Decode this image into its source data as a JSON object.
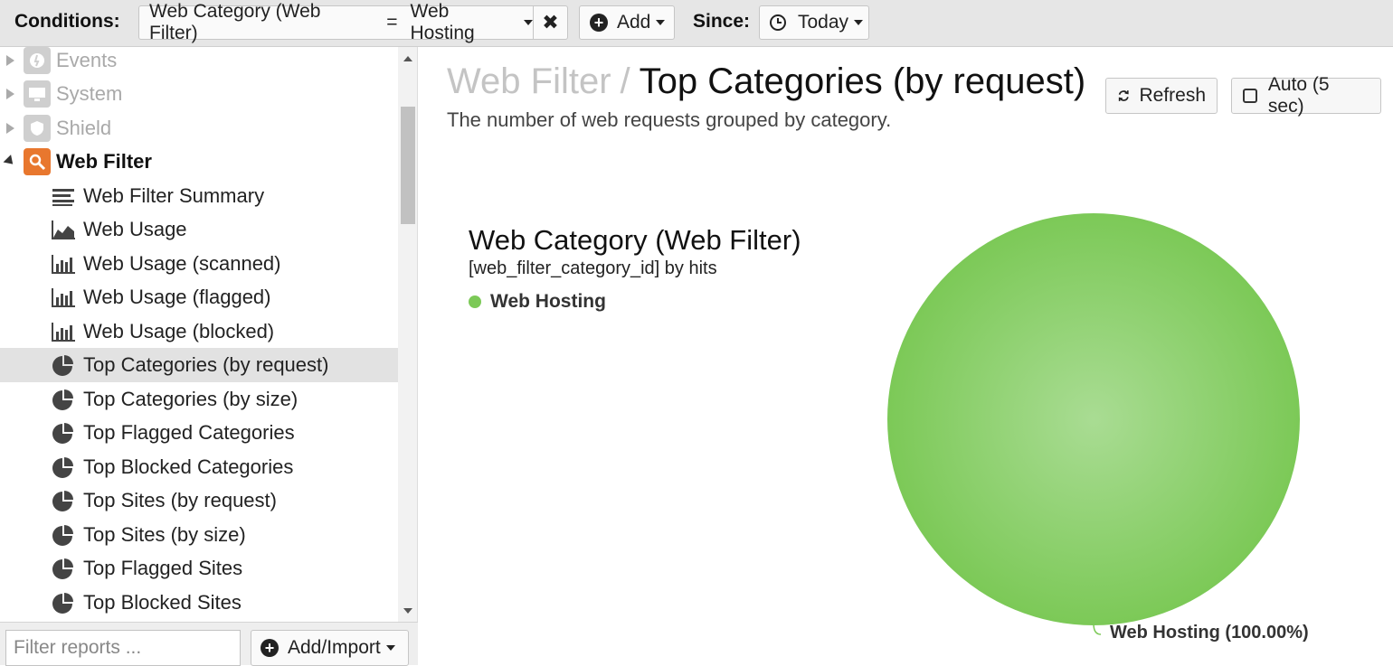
{
  "conditions": {
    "label": "Conditions:",
    "chip_field": "Web Category (Web Filter)",
    "chip_operator": "=",
    "chip_value": "Web Hosting",
    "add_label": "Add",
    "since_label": "Since:",
    "since_value": "Today"
  },
  "sidebar": {
    "parents": [
      {
        "label": "Events",
        "icon": "events-icon"
      },
      {
        "label": "System",
        "icon": "system-icon"
      },
      {
        "label": "Shield",
        "icon": "shield-icon"
      },
      {
        "label": "Web Filter",
        "icon": "web-filter-icon"
      }
    ],
    "items": [
      {
        "label": "Web Filter Summary",
        "icon": "text-summary-icon"
      },
      {
        "label": "Web Usage",
        "icon": "area-chart-icon"
      },
      {
        "label": "Web Usage (scanned)",
        "icon": "bar-chart-icon"
      },
      {
        "label": "Web Usage (flagged)",
        "icon": "bar-chart-icon"
      },
      {
        "label": "Web Usage (blocked)",
        "icon": "bar-chart-icon"
      },
      {
        "label": "Top Categories (by request)",
        "icon": "pie-chart-icon"
      },
      {
        "label": "Top Categories (by size)",
        "icon": "pie-chart-icon"
      },
      {
        "label": "Top Flagged Categories",
        "icon": "pie-chart-icon"
      },
      {
        "label": "Top Blocked Categories",
        "icon": "pie-chart-icon"
      },
      {
        "label": "Top Sites (by request)",
        "icon": "pie-chart-icon"
      },
      {
        "label": "Top Sites (by size)",
        "icon": "pie-chart-icon"
      },
      {
        "label": "Top Flagged Sites",
        "icon": "pie-chart-icon"
      },
      {
        "label": "Top Blocked Sites",
        "icon": "pie-chart-icon"
      }
    ],
    "filter_placeholder": "Filter reports ...",
    "add_import_label": "Add/Import"
  },
  "main": {
    "breadcrumb_parent": "Web Filter",
    "breadcrumb_sep": "/",
    "title": "Top Categories (by request)",
    "subtitle": "The number of web requests grouped by category.",
    "refresh_label": "Refresh",
    "auto_label": "Auto (5 sec)"
  },
  "chart_data": {
    "type": "pie",
    "title": "Web Category (Web Filter)",
    "subtitle": "[web_filter_category_id] by hits",
    "legend_position": "top-left",
    "series": [
      {
        "name": "Web Hosting",
        "values": [
          100.0
        ]
      }
    ],
    "categories": [
      "Web Hosting"
    ],
    "data_labels": [
      "Web Hosting (100.00%)"
    ],
    "colors": {
      "Web Hosting": "#7cc957"
    }
  }
}
